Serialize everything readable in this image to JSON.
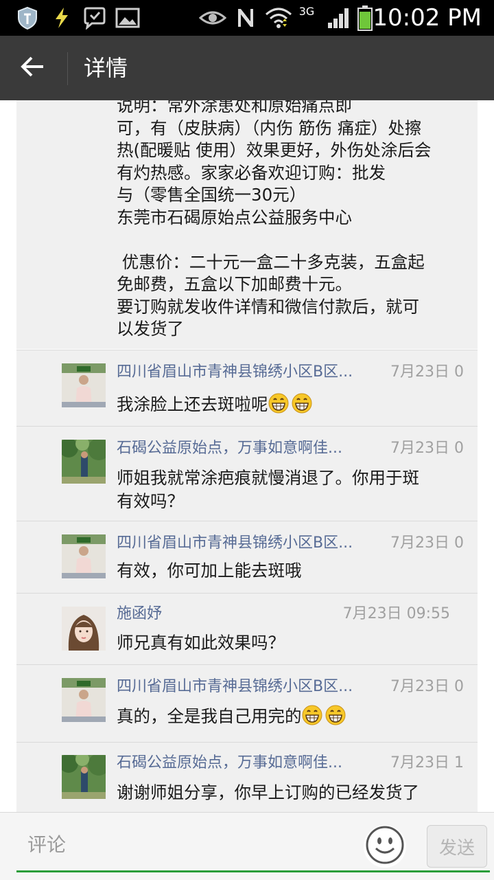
{
  "statusbar": {
    "time": "10:02 PM",
    "network_label": "3G",
    "icons": [
      "shield-icon",
      "flash-icon",
      "chat-bubble-icon",
      "gallery-icon",
      "eye-icon",
      "n-icon",
      "wifi-icon",
      "signal-icon",
      "battery-icon"
    ]
  },
  "appbar": {
    "title": "详情",
    "back_icon": "arrow-left-icon"
  },
  "post": {
    "text": "说明：常外涂患处和原始痛点即\n可，有（皮肤病）（内伤 筋伤 痛症）处擦\n热(配暖贴 使用）效果更好，外伤处涂后会\n有灼热感。家家必备欢迎订购：批发\n与（零售全国统一30元）\n东莞市石碣原始点公益服务中心\n\n 优惠价：二十元一盒二十多克装，五盒起\n免邮费，五盒以下加邮费十元。\n要订购就发收件详情和微信付款后，就可\n以发货了"
  },
  "comments": [
    {
      "name": "四川省眉山市青神县锦绣小区B区...",
      "time": "7月23日 0",
      "text": "我涂脸上还去斑啦呢",
      "emoji_count": 2
    },
    {
      "name": "石碣公益原始点，万事如意啊佳...",
      "time": "7月23日 0",
      "text": "师姐我就常涂疤痕就慢消退了。你用于斑\n有效吗？",
      "emoji_count": 0
    },
    {
      "name": "四川省眉山市青神县锦绣小区B区...",
      "time": "7月23日 0",
      "text": "有效，你可加上能去斑哦",
      "emoji_count": 0
    },
    {
      "name": "施函妤",
      "time": "7月23日 09:55",
      "text": "师兄真有如此效果吗？",
      "emoji_count": 0
    },
    {
      "name": "四川省眉山市青神县锦绣小区B区...",
      "time": "7月23日 0",
      "text": "真的，全是我自己用完的",
      "emoji_count": 2
    },
    {
      "name": "石碣公益原始点，万事如意啊佳...",
      "time": "7月23日 1",
      "text": "谢谢师姐分享，你早上订购的已经发货了",
      "emoji_count": 0
    }
  ],
  "inputbar": {
    "placeholder": "评论",
    "send_label": "发送",
    "emoji_icon": "smiley-icon"
  },
  "colors": {
    "name_link": "#576b95",
    "accent_underline": "#2a9d3a",
    "appbar_bg": "#3a3a3a",
    "bubble_bg": "#f0f0f0"
  }
}
